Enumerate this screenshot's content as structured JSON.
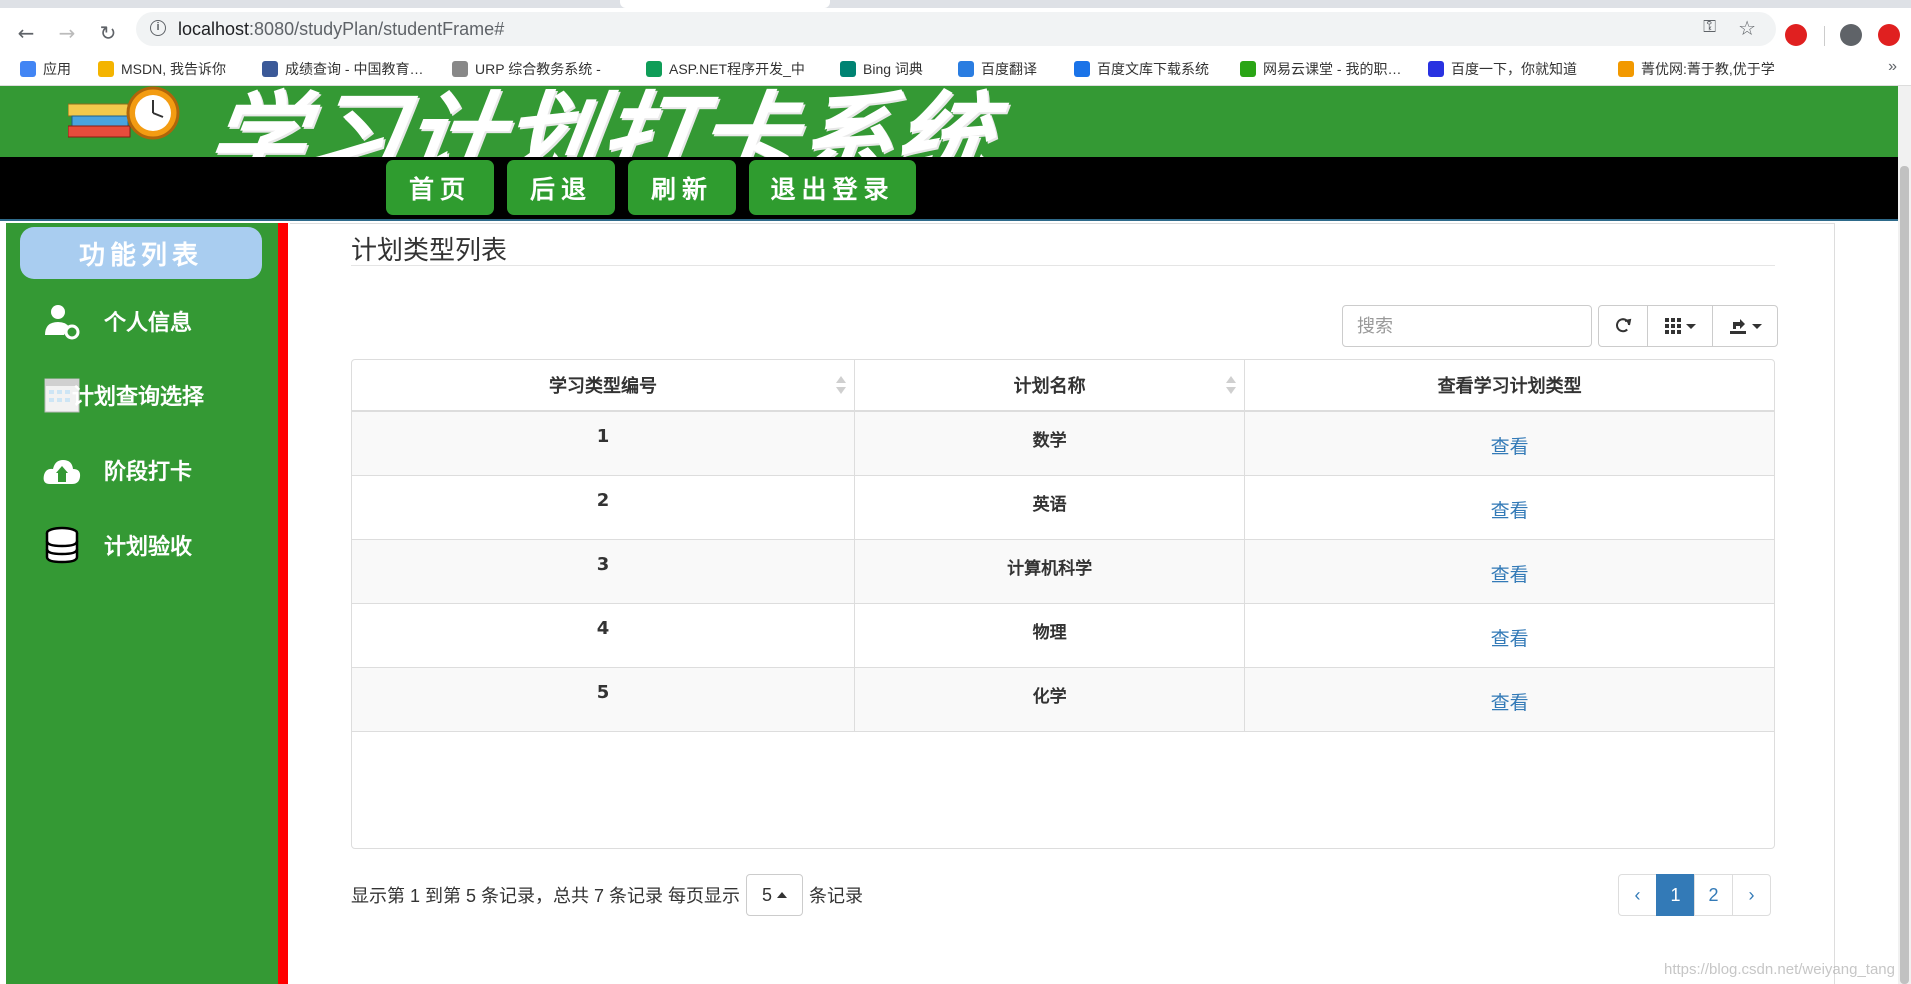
{
  "browser": {
    "url_host": "localhost",
    "url_rest": ":8080/studyPlan/studentFrame#",
    "bookmarks": [
      {
        "label": "应用",
        "color": "#4285f4"
      },
      {
        "label": "MSDN, 我告诉你",
        "color": "#f4b400"
      },
      {
        "label": "成绩查询 - 中国教育…",
        "color": "#3b5998"
      },
      {
        "label": "URP 综合教务系统 -",
        "color": "#888888"
      },
      {
        "label": "ASP.NET程序开发_中",
        "color": "#0f9d58"
      },
      {
        "label": "Bing 词典",
        "color": "#008373"
      },
      {
        "label": "百度翻译",
        "color": "#2a7de1"
      },
      {
        "label": "百度文库下载系统",
        "color": "#1a73e8"
      },
      {
        "label": "网易云课堂 - 我的职…",
        "color": "#2aa515"
      },
      {
        "label": "百度一下，你就知道",
        "color": "#2932e1"
      },
      {
        "label": "菁优网:菁于教,优于学",
        "color": "#f29900"
      }
    ],
    "more_label": "»"
  },
  "header": {
    "title": "学习计划打卡系统",
    "nav": [
      {
        "label": "首页"
      },
      {
        "label": "后退"
      },
      {
        "label": "刷新"
      },
      {
        "label": "退出登录"
      }
    ]
  },
  "sidebar": {
    "title": "功能列表",
    "items": [
      {
        "label": "个人信息",
        "icon": "user-gear-icon"
      },
      {
        "label": "计划查询选择",
        "icon": "calendar-icon"
      },
      {
        "label": "阶段打卡",
        "icon": "cloud-upload-icon"
      },
      {
        "label": "计划验收",
        "icon": "database-icon"
      }
    ]
  },
  "main": {
    "page_title": "计划类型列表",
    "search_placeholder": "搜索",
    "columns": [
      "学习类型编号",
      "计划名称",
      "查看学习计划类型"
    ],
    "rows": [
      {
        "id": "1",
        "name": "数学",
        "action": "查看"
      },
      {
        "id": "2",
        "name": "英语",
        "action": "查看"
      },
      {
        "id": "3",
        "name": "计算机科学",
        "action": "查看"
      },
      {
        "id": "4",
        "name": "物理",
        "action": "查看"
      },
      {
        "id": "5",
        "name": "化学",
        "action": "查看"
      }
    ],
    "pagination": {
      "info_prefix": "显示第 1 到第 5 条记录，总共 7 条记录 每页显示",
      "page_size": "5",
      "info_suffix": "条记录",
      "prev": "‹",
      "pages": [
        "1",
        "2"
      ],
      "current": "1",
      "next": "›"
    }
  },
  "watermark": "https://blog.csdn.net/weiyang_tang",
  "colors": {
    "header_green": "#349934",
    "sidebar_title_bg": "#a9cdf0",
    "separator_red": "#ff0000",
    "link_blue": "#337ab7"
  }
}
